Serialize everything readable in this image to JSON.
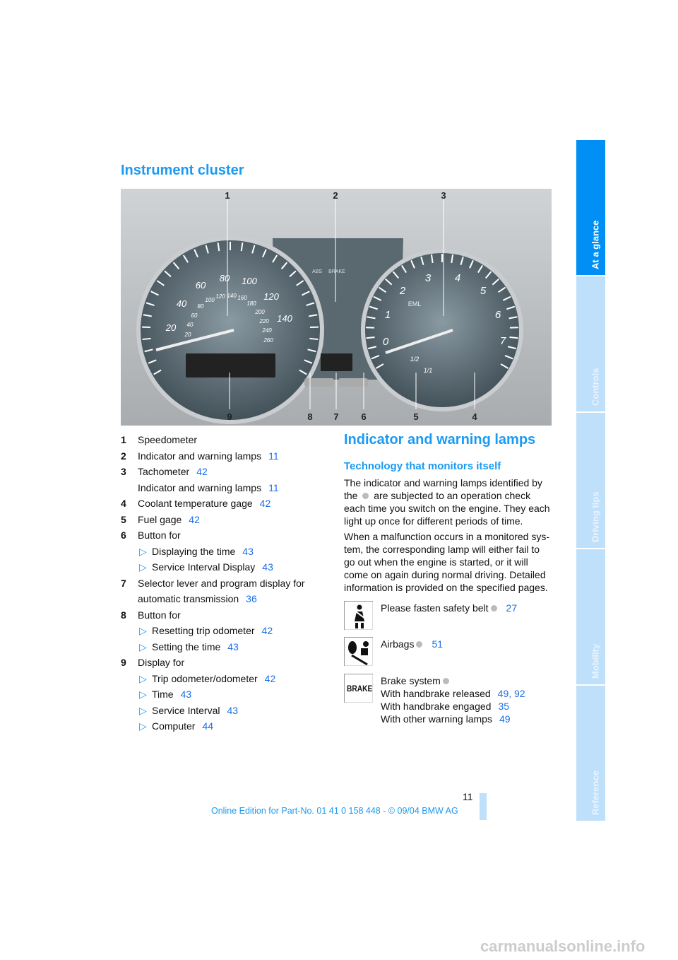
{
  "section_title": "Instrument cluster",
  "cluster_callouts": {
    "top": [
      "1",
      "2",
      "3"
    ],
    "bottom": [
      "9",
      "8",
      "7",
      "6",
      "5",
      "4"
    ]
  },
  "gauge_text": {
    "speed_mph": [
      "20",
      "40",
      "60",
      "80",
      "100",
      "120",
      "140"
    ],
    "speed_kmh": [
      "20",
      "40",
      "60",
      "80",
      "100",
      "120",
      "140",
      "160",
      "180",
      "200",
      "220",
      "240",
      "260"
    ],
    "tach": [
      "0",
      "1",
      "2",
      "3",
      "4",
      "5",
      "6",
      "7"
    ],
    "fuel": [
      "1/2",
      "1/1"
    ],
    "eml": "EML",
    "brake": "BRAKE",
    "abs": "ABS"
  },
  "items": [
    {
      "num": "1",
      "label": "Speedometer"
    },
    {
      "num": "2",
      "label": "Indicator and warning lamps",
      "page": "11"
    },
    {
      "num": "3",
      "label": "Tachometer",
      "page": "42"
    },
    {
      "num": "",
      "label": "Indicator and warning lamps",
      "page": "11"
    },
    {
      "num": "4",
      "label": "Coolant temperature gage",
      "page": "42"
    },
    {
      "num": "5",
      "label": "Fuel gage",
      "page": "42"
    },
    {
      "num": "6",
      "label": "Button for",
      "subs": [
        {
          "label": "Displaying the time",
          "page": "43"
        },
        {
          "label": "Service Interval Display",
          "page": "43"
        }
      ]
    },
    {
      "num": "7",
      "label": "Selector lever and program display for automatic transmission",
      "page": "36"
    },
    {
      "num": "8",
      "label": "Button for",
      "subs": [
        {
          "label": "Resetting trip odometer",
          "page": "42"
        },
        {
          "label": "Setting the time",
          "page": "43"
        }
      ]
    },
    {
      "num": "9",
      "label": "Display for",
      "subs": [
        {
          "label": "Trip odometer/odometer",
          "page": "42"
        },
        {
          "label": "Time",
          "page": "43"
        },
        {
          "label": "Service Interval",
          "page": "43"
        },
        {
          "label": "Computer",
          "page": "44"
        }
      ]
    }
  ],
  "right": {
    "title": "Indicator and warning lamps",
    "subtitle": "Technology that monitors itself",
    "p1a": "The indicator and warning lamps identified by the",
    "p1b": "are subjected to an operation check each time you switch on the engine. They each light up once for different periods of time.",
    "p2": "When a malfunction occurs in a monitored sys­tem, the corresponding lamp will either fail to go out when the engine is started, or it will come on again during normal driving. Detailed informa­tion is provided on the specified pages.",
    "lamps": [
      {
        "icon": "seatbelt-icon",
        "lines": [
          {
            "text": "Please fasten safety belt",
            "dot": true,
            "pages": "27"
          }
        ]
      },
      {
        "icon": "airbag-icon",
        "lines": [
          {
            "text": "Airbags",
            "dot": true,
            "pages": "51"
          }
        ]
      },
      {
        "icon": "brake-icon",
        "icon_text": "BRAKE",
        "lines": [
          {
            "text": "Brake system",
            "dot": true,
            "pages": ""
          },
          {
            "text": "With handbrake released",
            "pages": "49, 92"
          },
          {
            "text": "With handbrake engaged",
            "pages": "35"
          },
          {
            "text": "With other warning lamps",
            "pages": "49"
          }
        ]
      }
    ]
  },
  "tabs": [
    {
      "label": "At a glance",
      "active": true
    },
    {
      "label": "Controls"
    },
    {
      "label": "Driving tips"
    },
    {
      "label": "Mobility"
    },
    {
      "label": "Reference"
    }
  ],
  "page_number": "11",
  "footer": "Online Edition for Part-No. 01 41 0 158 448 - © 09/04 BMW AG",
  "watermark": "carmanualsonline.info",
  "colors": {
    "accent": "#1a9af2",
    "link": "#1a6fe8",
    "tab_active": "#0090f5",
    "tab_inactive": "#bfe0fb"
  }
}
